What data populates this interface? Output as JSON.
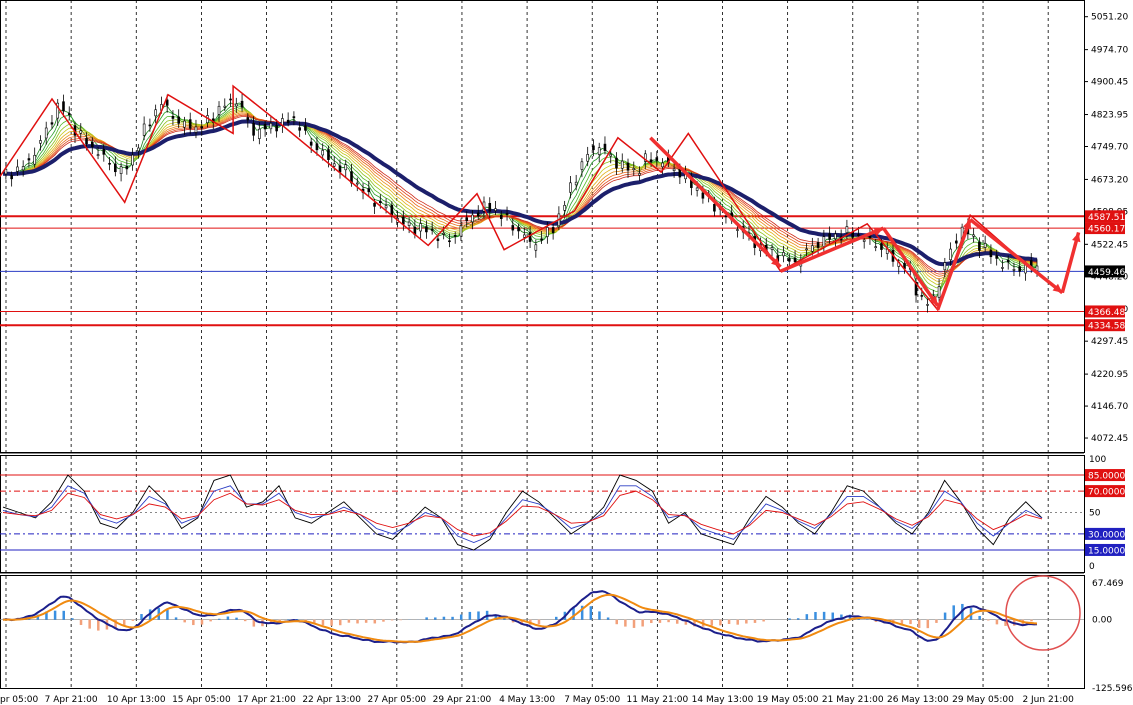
{
  "chart_data": [
    {
      "type": "candlestick",
      "panel": "price",
      "title": "",
      "ylim": [
        4040,
        5090
      ],
      "y_ticks": [
        "5051.20",
        "4974.70",
        "4900.45",
        "4823.95",
        "4749.70",
        "4673.20",
        "4598.95",
        "4522.45",
        "4448.20",
        "4371.70",
        "4297.45",
        "4220.95",
        "4146.70",
        "4072.45"
      ],
      "x_labels": [
        "pr 05:00",
        "7 Apr 21:00",
        "10 Apr 13:00",
        "15 Apr 05:00",
        "17 Apr 21:00",
        "22 Apr 13:00",
        "27 Apr 05:00",
        "29 Apr 21:00",
        "4 May 13:00",
        "7 May 05:00",
        "11 May 21:00",
        "14 May 13:00",
        "19 May 05:00",
        "21 May 21:00",
        "26 May 13:00",
        "29 May 05:00",
        "2 Jun 21:00"
      ],
      "close_path": [
        4680,
        4690,
        4700,
        4720,
        4760,
        4800,
        4850,
        4820,
        4780,
        4760,
        4740,
        4720,
        4700,
        4690,
        4730,
        4780,
        4820,
        4850,
        4830,
        4800,
        4800,
        4790,
        4810,
        4830,
        4850,
        4860,
        4820,
        4780,
        4790,
        4800,
        4800,
        4820,
        4790,
        4760,
        4740,
        4720,
        4700,
        4690,
        4660,
        4640,
        4620,
        4610,
        4590,
        4570,
        4560,
        4560,
        4550,
        4540,
        4530,
        4560,
        4580,
        4600,
        4610,
        4600,
        4580,
        4560,
        4540,
        4520,
        4540,
        4560,
        4600,
        4660,
        4700,
        4740,
        4750,
        4730,
        4710,
        4700,
        4690,
        4720,
        4720,
        4710,
        4700,
        4680,
        4660,
        4640,
        4620,
        4600,
        4580,
        4560,
        4540,
        4520,
        4510,
        4500,
        4490,
        4480,
        4500,
        4520,
        4530,
        4540,
        4545,
        4550,
        4540,
        4530,
        4520,
        4500,
        4480,
        4470,
        4420,
        4380,
        4400,
        4470,
        4520,
        4560,
        4540,
        4520,
        4500,
        4480,
        4470,
        4465,
        4470,
        4470
      ],
      "levels": [
        {
          "label": "4587.51",
          "value": 4587.51,
          "color": "#e01010",
          "style": "thick"
        },
        {
          "label": "4560.17",
          "value": 4560.17,
          "color": "#e01010",
          "style": "thin"
        },
        {
          "label": "4459.46",
          "value": 4459.46,
          "color": "#2b3dc4",
          "style": "thin",
          "current": true
        },
        {
          "label": "4366.48",
          "value": 4366.48,
          "color": "#e01010",
          "style": "thin"
        },
        {
          "label": "4334.58",
          "value": 4334.58,
          "color": "#e01010",
          "style": "thick"
        }
      ],
      "zigzag": [
        [
          0,
          4680
        ],
        [
          0.048,
          4860
        ],
        [
          0.115,
          4620
        ],
        [
          0.155,
          4870
        ],
        [
          0.215,
          4780
        ],
        [
          0.215,
          4890
        ],
        [
          0.255,
          4810
        ],
        [
          0.395,
          4520
        ],
        [
          0.44,
          4640
        ],
        [
          0.465,
          4510
        ],
        [
          0.53,
          4600
        ],
        [
          0.57,
          4770
        ],
        [
          0.61,
          4690
        ],
        [
          0.635,
          4780
        ],
        [
          0.72,
          4460
        ],
        [
          0.8,
          4570
        ],
        [
          0.865,
          4370
        ],
        [
          0.895,
          4590
        ],
        [
          0.945,
          4480
        ]
      ],
      "arrows": [
        [
          [
            0.6,
            4770
          ],
          [
            0.72,
            4470
          ]
        ],
        [
          [
            0.72,
            4460
          ],
          [
            0.815,
            4560
          ]
        ],
        [
          [
            0.815,
            4560
          ],
          [
            0.865,
            4380
          ]
        ],
        [
          [
            0.865,
            4370
          ],
          [
            0.895,
            4580
          ]
        ],
        [
          [
            0.895,
            4580
          ],
          [
            0.98,
            4410
          ]
        ],
        [
          [
            0.98,
            4410
          ],
          [
            0.995,
            4550
          ]
        ]
      ]
    },
    {
      "type": "line",
      "panel": "stochastic",
      "ylim": [
        0,
        100
      ],
      "y_ticks": [
        "100",
        "50",
        "0"
      ],
      "levels": [
        {
          "label": "85.0000",
          "value": 85,
          "color": "#e01010"
        },
        {
          "label": "70.0000",
          "value": 70,
          "color": "#e01010",
          "dash": true
        },
        {
          "label": "30.0000",
          "value": 30,
          "color": "#2020c0",
          "dash": true
        },
        {
          "label": "15.0000",
          "value": 15,
          "color": "#2020c0"
        }
      ],
      "series": [
        {
          "color": "#000000",
          "values": [
            55,
            50,
            45,
            60,
            85,
            70,
            40,
            35,
            50,
            75,
            60,
            35,
            45,
            80,
            85,
            55,
            60,
            75,
            45,
            40,
            50,
            60,
            45,
            30,
            25,
            40,
            55,
            45,
            20,
            15,
            25,
            50,
            70,
            60,
            45,
            30,
            40,
            55,
            85,
            80,
            70,
            40,
            50,
            30,
            25,
            20,
            45,
            65,
            55,
            40,
            30,
            50,
            75,
            70,
            55,
            40,
            30,
            50,
            80,
            60,
            35,
            20,
            45,
            60,
            45
          ]
        },
        {
          "color": "#2b3dc4",
          "values": [
            52,
            48,
            46,
            55,
            75,
            68,
            45,
            40,
            48,
            65,
            58,
            40,
            46,
            70,
            75,
            58,
            58,
            68,
            50,
            45,
            48,
            55,
            48,
            35,
            30,
            38,
            50,
            45,
            28,
            22,
            28,
            45,
            62,
            58,
            48,
            35,
            40,
            50,
            75,
            75,
            65,
            45,
            48,
            35,
            30,
            25,
            40,
            58,
            52,
            42,
            35,
            48,
            65,
            65,
            55,
            42,
            35,
            48,
            70,
            60,
            40,
            28,
            40,
            52,
            45
          ]
        },
        {
          "color": "#e01010",
          "values": [
            50,
            48,
            47,
            52,
            68,
            64,
            48,
            44,
            48,
            58,
            55,
            44,
            47,
            62,
            68,
            58,
            57,
            62,
            52,
            48,
            48,
            52,
            48,
            40,
            36,
            40,
            47,
            45,
            34,
            28,
            31,
            42,
            56,
            55,
            48,
            40,
            41,
            47,
            66,
            70,
            62,
            48,
            47,
            39,
            34,
            30,
            38,
            52,
            50,
            44,
            38,
            46,
            58,
            60,
            53,
            44,
            38,
            46,
            62,
            58,
            44,
            34,
            40,
            48,
            44
          ]
        }
      ]
    },
    {
      "type": "histogram",
      "panel": "macd",
      "ylim": [
        -125.5969,
        67.469
      ],
      "y_ticks": [
        "67.469",
        "0.00",
        "-125.5969"
      ],
      "annotation": "circle-highlight"
    }
  ]
}
